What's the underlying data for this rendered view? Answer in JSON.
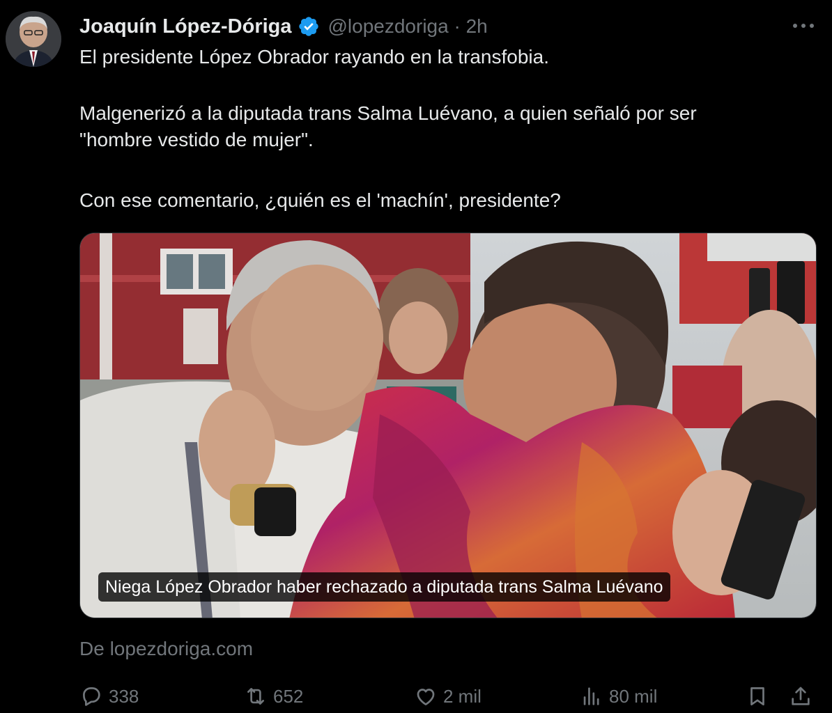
{
  "author": {
    "name": "Joaquín López-Dóriga",
    "handle": "@lopezdoriga",
    "time": "2h",
    "verified": true
  },
  "header": {
    "handle_time": "@lopezdoriga · 2h"
  },
  "tweet": {
    "paragraph1": "El presidente López Obrador rayando en la transfobia.",
    "paragraph2_line1": "Malgenerizó a la diputada trans Salma Luévano, a quien señaló por ser",
    "paragraph2_line2": "\"hombre vestido de mujer\".",
    "paragraph3": "Con ese comentario, ¿quién es el 'machín', presidente?"
  },
  "media": {
    "caption": "Niega López Obrador haber rechazado a diputada trans Salma Luévano"
  },
  "source": {
    "text": "De lopezdoriga.com"
  },
  "actions": {
    "replies": "338",
    "reposts": "652",
    "likes": "2 mil",
    "views": "80 mil"
  },
  "icons": {
    "verified": "verified-badge-icon",
    "more": "more-icon",
    "reply": "reply-icon",
    "repost": "repost-icon",
    "like": "heart-icon",
    "views": "views-icon",
    "bookmark": "bookmark-icon",
    "share": "share-icon"
  },
  "colors": {
    "background": "#000000",
    "text": "#e7e9ea",
    "muted": "#71767b",
    "verified": "#1d9bf0"
  }
}
